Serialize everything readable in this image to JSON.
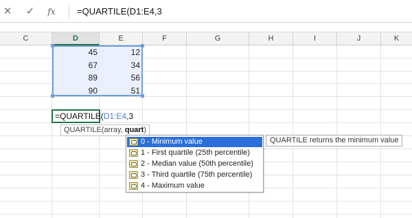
{
  "formula_bar": {
    "cancel_icon": "✕",
    "enter_icon": "✓",
    "fx_label": "fx",
    "formula_text": "=QUARTILE(D1:E4,3"
  },
  "columns": [
    "C",
    "D",
    "E",
    "F",
    "G",
    "H",
    "I",
    "J",
    "K"
  ],
  "active_column": "D",
  "cells": {
    "D": [
      "45",
      "67",
      "89",
      "90"
    ],
    "E": [
      "12",
      "34",
      "56",
      "51"
    ]
  },
  "edit_cell": {
    "prefix": "=QUARTILE(",
    "reference": "D1:E4",
    "suffix": ",3"
  },
  "argument_tooltip": {
    "function_name": "QUARTILE(",
    "arg1": "array, ",
    "arg2_bold": "quart",
    "close": ")"
  },
  "autocomplete": {
    "items": [
      "0 - Minimum value",
      "1 - First quartile (25th percentile)",
      "2 - Median value (50th percentile)",
      "3 - Third quartile (75th percentile)",
      "4 - Maximum value"
    ],
    "selected_index": 0
  },
  "description_tooltip": "QUARTILE returns the minimum value",
  "colors": {
    "accent_green": "#217346",
    "selection_blue": "#2d6fd8",
    "range_border": "#6f9ee0",
    "reference_text": "#4a7fd6"
  }
}
